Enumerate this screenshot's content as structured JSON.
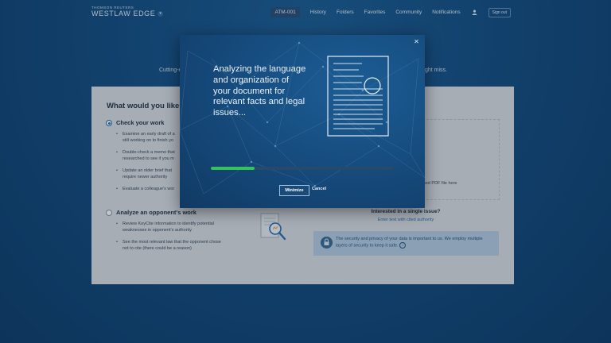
{
  "header": {
    "brand": "THOMSON REUTERS",
    "product": "WESTLAW EDGE",
    "client_id": "ATM-001",
    "nav": [
      "History",
      "Folders",
      "Favorites",
      "Community",
      "Notifications"
    ],
    "user_icon": "user-icon",
    "sign_out": "Sign out"
  },
  "tagline": {
    "left_fragment": "Cutting-e",
    "right_fragment": "ght miss."
  },
  "card": {
    "heading": "What would you like to",
    "option1": {
      "title": "Check your work",
      "selected": true,
      "bullets": [
        "Examine an early draft of a\nstill working on to finish yo",
        "Double-check a memo that\nresearched to see if you m",
        "Update an older brief that\nrequire newer authority",
        "Evaluate a colleague's wor"
      ]
    },
    "option2": {
      "title": "Analyze an opponent's work",
      "selected": false,
      "bullets": [
        "Review KeyCite information to identify potential\nweaknesses in opponent's authority",
        "See the most relevant law that the opponent chose\nnot to cite (there could be a reason)"
      ]
    },
    "drop_text": "sed PDF file here",
    "interest_title": "Interested in a single issue?",
    "interest_link": "Enter text with cited authority",
    "security_text": "The security and privacy of your data is important to us. We employ multiple layers of security to keep it safe.",
    "info_icon": "info-icon"
  },
  "modal": {
    "message": "Analyzing the language and organization of your document for relevant facts and legal issues...",
    "progress": 0.24,
    "progress_color": "#35c25a",
    "minimize_label": "Minimize",
    "cancel_label": "Cancel",
    "close_icon": "close-icon"
  }
}
